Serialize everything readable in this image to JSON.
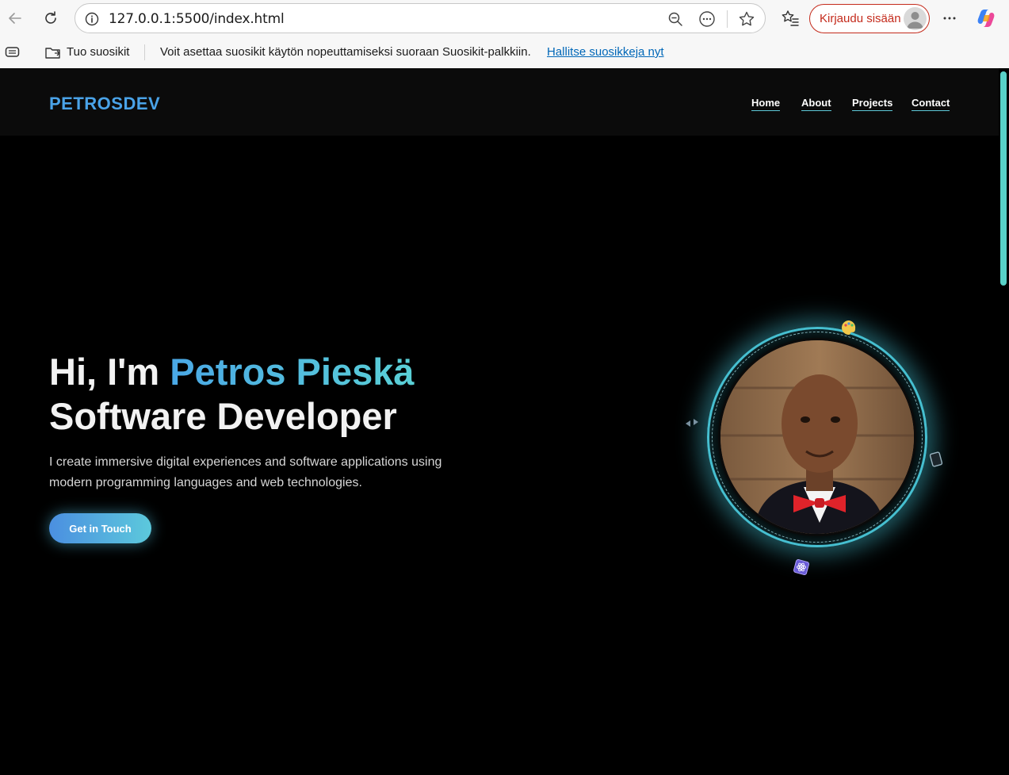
{
  "browser": {
    "url": "127.0.0.1:5500/index.html",
    "signin_label": "Kirjaudu sisään",
    "favorites_import": "Tuo suosikit",
    "favorites_message": "Voit asettaa suosikit käytön nopeuttamiseksi suoraan Suosikit-palkkiin.",
    "favorites_manage_link": "Hallitse suosikkeja nyt",
    "icons": [
      "back-arrow-icon",
      "refresh-icon",
      "site-info-icon",
      "zoom-out-icon",
      "read-aloud-icon",
      "favorite-star-icon",
      "favorites-list-icon",
      "more-menu-icon",
      "copilot-icon",
      "tab-actions-icon",
      "import-favorites-icon"
    ],
    "accent_color": "#c42b1c"
  },
  "site": {
    "logo": "PETROSDEV",
    "nav": {
      "home": "Home",
      "about": "About",
      "projects": "Projects",
      "contact": "Contact"
    },
    "hero": {
      "greeting": "Hi, I'm ",
      "name": "Petros Pieskä",
      "role": "Software Developer",
      "description": "I create immersive digital experiences and software applications using modern programming languages and web technologies.",
      "cta_label": "Get in Touch"
    },
    "orbit_icons": [
      "palette-icon",
      "code-icon",
      "device-icon",
      "react-icon"
    ],
    "colors": {
      "logo": "#4aa3e8",
      "accent_teal": "#5ad0d6",
      "background": "#000000",
      "header_background": "#0b0b0b"
    }
  }
}
